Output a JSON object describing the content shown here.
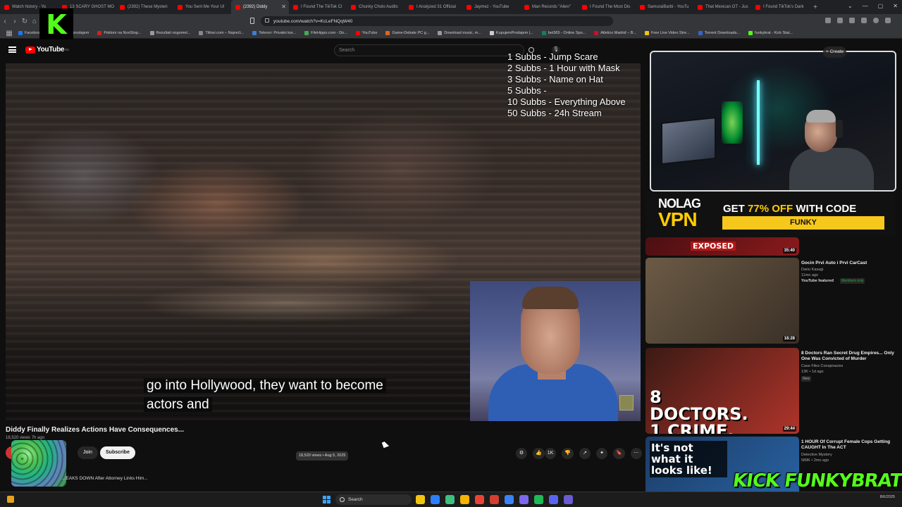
{
  "browser": {
    "tabs": [
      {
        "label": "Watch history - Yo",
        "color": "#ff0000"
      },
      {
        "label": "13 SCARY GHOST MO",
        "color": "#ff0000"
      },
      {
        "label": "(2392) These Mysteri",
        "color": "#ff0000"
      },
      {
        "label": "You Sent Me Your Ul",
        "color": "#ff0000"
      },
      {
        "label": "(2392) Diddy",
        "color": "#ff0000",
        "active": true
      },
      {
        "label": "I Found The TikTok Cl",
        "color": "#ff0000"
      },
      {
        "label": "Chunky Cholo Audits",
        "color": "#ff0000"
      },
      {
        "label": "I Analyzed 31 Official",
        "color": "#ff0000"
      },
      {
        "label": "Jaymez - YouTube",
        "color": "#ff0000"
      },
      {
        "label": "Man Records \"Alien\"",
        "color": "#ff0000"
      },
      {
        "label": "I Found The Most Dis",
        "color": "#ff0000"
      },
      {
        "label": "SamuraiBarbi - YouTu",
        "color": "#ff0000"
      },
      {
        "label": "That Mexican OT - Jus",
        "color": "#ff0000"
      },
      {
        "label": "I Found TikTok's Dark",
        "color": "#ff0000"
      }
    ],
    "new_tab": "+",
    "window_controls": [
      "⌄",
      "—",
      "▢",
      "✕"
    ],
    "url": "youtube.com/watch?v=KcLeFNQqW40",
    "bookmarks": [
      {
        "label": "Facebook",
        "color": "#1877f2"
      },
      {
        "label": "Kupujem prodajem",
        "color": "#666666"
      },
      {
        "label": "Pokloni na NonStop...",
        "color": "#cc2222"
      },
      {
        "label": "Rezultati nogomet...",
        "color": "#999999"
      },
      {
        "label": "Titlovi.com – Najveći...",
        "color": "#888888"
      },
      {
        "label": "Telenor: Privatni kor...",
        "color": "#3b7fd6"
      },
      {
        "label": "FileHippo.com - Do...",
        "color": "#44aa55"
      },
      {
        "label": "YouTube",
        "color": "#ff0000"
      },
      {
        "label": "Game-Debate PC g...",
        "color": "#dd6622"
      },
      {
        "label": "Download music, m...",
        "color": "#999999"
      },
      {
        "label": "KupujemProdajem |...",
        "color": "#cccccc"
      },
      {
        "label": "bet365 - Online Spo...",
        "color": "#14805e"
      },
      {
        "label": "Atletico Madrid – B...",
        "color": "#c8102e"
      },
      {
        "label": "Free Live Video Stre...",
        "color": "#f1c40f"
      },
      {
        "label": "Torrent Downloads...",
        "color": "#3366cc"
      },
      {
        "label": "funkybrat - Kick Stat...",
        "color": "#53fc18"
      }
    ]
  },
  "kick_logo": "K",
  "youtube": {
    "logo_text": "YouTube",
    "logo_region": "RS",
    "search_placeholder": "Search",
    "mic": "🎙",
    "create_label": "+ Create"
  },
  "subgoals": [
    "1 Subbs - Jump Scare",
    "2 Subbs - 1 Hour with Mask",
    "3 Subbs - Name on Hat",
    "5 Subbs -",
    "10 Subbs - Everything Above",
    "50 Subbs - 24h Stream"
  ],
  "video": {
    "caption_line1": "go into Hollywood, they want to become",
    "caption_line2": "actors and",
    "title": "Diddy Finally Realizes Actions Have Consequences...",
    "views_short": "18,520 views  7h ago",
    "join_label": "Join",
    "subscribe_label": "Subscribe",
    "date_pill": "18,520 views • Aug 5, 2025",
    "like_count": "1K",
    "next_up": "...EAKS DOWN After Attorney Links Him..."
  },
  "actions": [
    {
      "icon": "settings-icon",
      "glyph": "⚙"
    },
    {
      "icon": "like-icon",
      "glyph": "👍"
    },
    {
      "icon": "dislike-icon",
      "glyph": "👎"
    },
    {
      "icon": "share-icon",
      "glyph": "↗"
    },
    {
      "icon": "sparkle-icon",
      "glyph": "✦"
    },
    {
      "icon": "save-icon",
      "glyph": "🔖"
    },
    {
      "icon": "more-icon",
      "glyph": "⋯"
    }
  ],
  "vpn_ad": {
    "logo_top": "NOLAG",
    "logo_bottom": "VPN",
    "offer_prefix": "GET",
    "offer_highlight": "77% OFF",
    "offer_suffix": "WITH CODE",
    "code": "FUNKY"
  },
  "related": [
    {
      "thumb_text": "EXPOSED",
      "duration": "35:40",
      "title": "",
      "channel": "",
      "meta": "",
      "colors": [
        "#4b0f12",
        "#8a1a1c"
      ]
    },
    {
      "thumb_text": "",
      "duration": "18:28",
      "title": "Gocin Prvi Auto i Prvi CarCast",
      "channel": "Dario Kasagi",
      "meta": "11mo ago",
      "featured": "YouTube featured",
      "badge": "Members only",
      "colors": [
        "#6b5a45",
        "#3a3026"
      ]
    },
    {
      "thumb_text": "8 DOCTORS. 1 CRIME.",
      "duration": "29:44",
      "title": "8 Doctors Ran Secret Drug Empires... Only One Was Convicted of Murder",
      "channel": "Case Files Conspiracies",
      "meta": "13K • 1d ago",
      "badge": "New",
      "colors": [
        "#3b1a14",
        "#b0342a"
      ]
    },
    {
      "thumb_text": "It's not what it looks like!",
      "duration": "",
      "title": "1 HOUR Of Corrupt Female Cops Getting CAUGHT In The ACT",
      "channel": "Detective Mystery",
      "meta": "589K • 2mo ago",
      "badge": "",
      "colors": [
        "#1c3c66",
        "#2a66a8"
      ]
    }
  ],
  "kick_brand": "KICK FUNKYBRAT",
  "taskbar": {
    "search_label": "Search",
    "apps": [
      "#f1c40f",
      "#2d7ff9",
      "#3fbf7f",
      "#f4b400",
      "#ea4335",
      "#d23f31",
      "#3b82f6",
      "#7b68ee",
      "#1db954",
      "#5865f2",
      "#6b5bd2"
    ],
    "tray_time": "",
    "tray_date": "8/6/2025"
  }
}
